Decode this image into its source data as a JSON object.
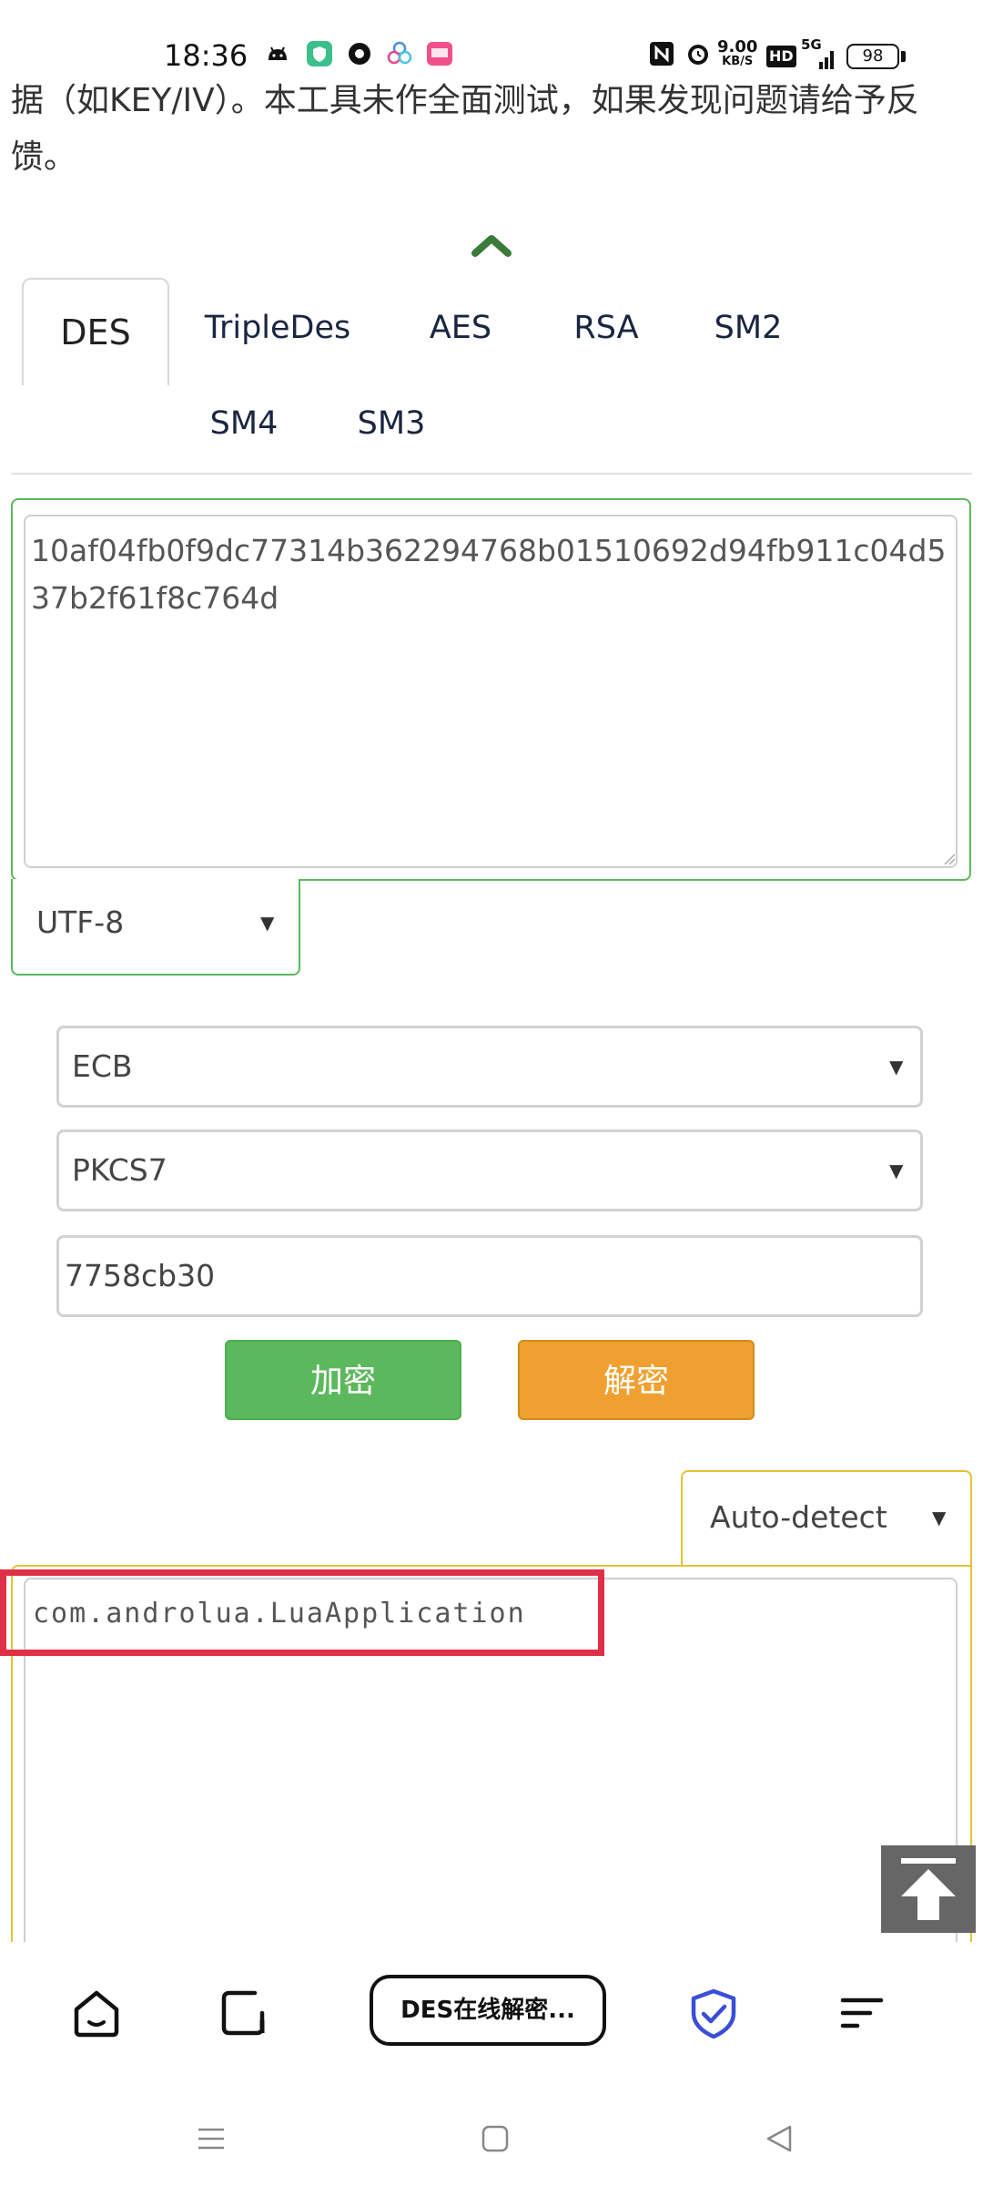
{
  "status_bar": {
    "time": "18:36",
    "speed_value": "9.00",
    "speed_unit": "KB/S",
    "hd": "HD",
    "network": "5G",
    "battery": "98",
    "icons": [
      "android-icon",
      "shield-app-icon",
      "circle-app-icon",
      "flower-app-icon",
      "pink-app-icon",
      "nfc-icon",
      "alarm-icon",
      "signal-icon",
      "battery-icon"
    ]
  },
  "intro": {
    "text": "据（如KEY/IV）。本工具未作全面测试，如果发现问题请给予反馈。"
  },
  "tabs": [
    {
      "label": "DES",
      "active": true
    },
    {
      "label": "TripleDes",
      "active": false
    },
    {
      "label": "AES",
      "active": false
    },
    {
      "label": "RSA",
      "active": false
    },
    {
      "label": "SM2",
      "active": false
    },
    {
      "label": "SM4",
      "active": false
    },
    {
      "label": "SM3",
      "active": false
    }
  ],
  "input": {
    "value": "10af04fb0f9dc77314b362294768b01510692d94fb911c04d537b2f61f8c764d",
    "encoding": "UTF-8"
  },
  "options": {
    "mode": "ECB",
    "padding": "PKCS7",
    "key": "7758cb30"
  },
  "buttons": {
    "encrypt": "加密",
    "decrypt": "解密"
  },
  "output": {
    "encoding": "Auto-detect",
    "value": "com.androlua.LuaApplication"
  },
  "browser_bar": {
    "tab_title": "DES在线解密..."
  },
  "colors": {
    "green": "#5cb85c",
    "orange": "#f0a030",
    "yellow_border": "#e6c135",
    "highlight_red": "#e03048",
    "shield_blue": "#3a4fd8",
    "chevron_green": "#3a7a3a"
  }
}
